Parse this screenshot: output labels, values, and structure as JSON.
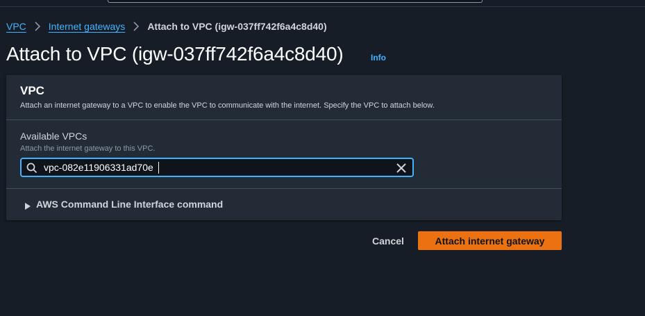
{
  "breadcrumb": {
    "items": [
      {
        "label": "VPC"
      },
      {
        "label": "Internet gateways"
      },
      {
        "label": "Attach to VPC (igw-037ff742f6a4c8d40)"
      }
    ]
  },
  "header": {
    "title": "Attach to VPC (igw-037ff742f6a4c8d40)",
    "info_label": "Info"
  },
  "panel": {
    "title": "VPC",
    "description": "Attach an internet gateway to a VPC to enable the VPC to communicate with the internet. Specify the VPC to attach below.",
    "field": {
      "label": "Available VPCs",
      "hint": "Attach the internet gateway to this VPC.",
      "value": "vpc-082e11906331ad70e"
    },
    "cli_label": "AWS Command Line Interface command"
  },
  "actions": {
    "cancel_label": "Cancel",
    "submit_label": "Attach internet gateway"
  },
  "icons": {
    "breadcrumb_separator": "chevron-right-icon",
    "search": "search-icon",
    "clear": "close-icon",
    "expand": "caret-right-icon"
  },
  "colors": {
    "background": "#161d26",
    "panel": "#232b37",
    "link": "#42b4ff",
    "primary_button": "#ec7211",
    "input_border_focus": "#42b4ff"
  }
}
